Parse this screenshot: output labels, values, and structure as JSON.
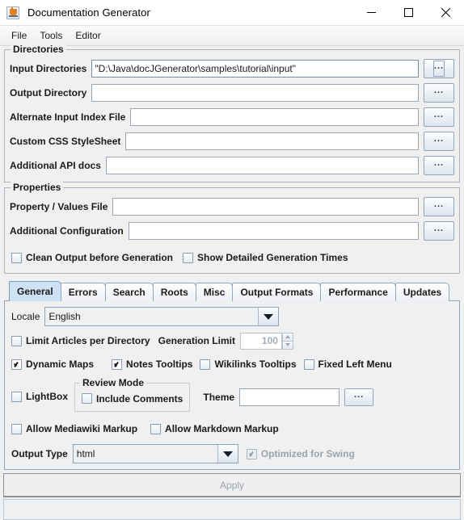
{
  "window": {
    "title": "Documentation Generator",
    "app_icon": "java-coffee-cup-icon",
    "minimize_label": "–",
    "maximize_label": "□",
    "close_label": "✕"
  },
  "menubar": {
    "items": [
      {
        "label": "File"
      },
      {
        "label": "Tools"
      },
      {
        "label": "Editor"
      }
    ]
  },
  "directories": {
    "title": "Directories",
    "browse_label": "...",
    "rows": [
      {
        "label": "Input Directories",
        "value": "\"D:\\Java\\docJGenerator\\samples\\tutorial\\input\"",
        "placeholder": ""
      },
      {
        "label": "Output Directory",
        "value": "",
        "placeholder": ""
      },
      {
        "label": "Alternate Input Index File",
        "value": "",
        "placeholder": ""
      },
      {
        "label": "Custom CSS StyleSheet",
        "value": "",
        "placeholder": ""
      },
      {
        "label": "Additional API docs",
        "value": "",
        "placeholder": ""
      }
    ]
  },
  "properties": {
    "title": "Properties",
    "browse_label": "...",
    "rows": [
      {
        "label": "Property / Values File",
        "value": "",
        "placeholder": ""
      },
      {
        "label": "Additional Configuration",
        "value": "",
        "placeholder": ""
      }
    ],
    "checkboxes": [
      {
        "label": "Clean Output before Generation",
        "checked": false
      },
      {
        "label": "Show Detailed Generation Times",
        "checked": false
      }
    ]
  },
  "tabs": {
    "items": [
      {
        "label": "General",
        "active": true
      },
      {
        "label": "Errors",
        "active": false
      },
      {
        "label": "Search",
        "active": false
      },
      {
        "label": "Roots",
        "active": false
      },
      {
        "label": "Misc",
        "active": false
      },
      {
        "label": "Output Formats",
        "active": false
      },
      {
        "label": "Performance",
        "active": false
      },
      {
        "label": "Updates",
        "active": false
      }
    ]
  },
  "general": {
    "locale_label": "Locale",
    "locale_value": "English",
    "limit_articles_label": "Limit Articles per Directory",
    "limit_articles_checked": false,
    "generation_limit_label": "Generation Limit",
    "generation_limit_value": "100",
    "toggles_row": [
      {
        "label": "Dynamic Maps",
        "checked": true
      },
      {
        "label": "Notes Tooltips",
        "checked": true
      },
      {
        "label": "Wikilinks Tooltips",
        "checked": false
      },
      {
        "label": "Fixed Left Menu",
        "checked": false
      }
    ],
    "lightbox_label": "LightBox",
    "lightbox_checked": false,
    "review_mode_title": "Review Mode",
    "include_comments_label": "Include Comments",
    "include_comments_checked": false,
    "theme_label": "Theme",
    "theme_value": "",
    "theme_browse_label": "...",
    "markup_row": [
      {
        "label": "Allow Mediawiki Markup",
        "checked": false
      },
      {
        "label": "Allow Markdown Markup",
        "checked": false
      }
    ],
    "output_type_label": "Output Type",
    "output_type_value": "html",
    "optimized_label": "Optimized for Swing",
    "optimized_checked": true
  },
  "footer": {
    "apply_label": "Apply",
    "status_text": ""
  },
  "colors": {
    "window_bg": "#f0f0f0",
    "titlebar_bg": "#ffffff",
    "active_tab": "#cde2f5",
    "border": "#93a6bb",
    "disabled_text": "#9aa3ad"
  }
}
